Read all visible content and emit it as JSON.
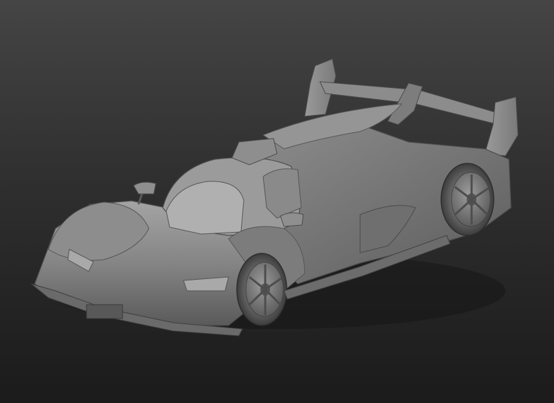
{
  "scene": {
    "subject": "",
    "material_color": "#8a8a8a",
    "background_top": "#454545",
    "background_bottom": "#1b1b1b"
  }
}
